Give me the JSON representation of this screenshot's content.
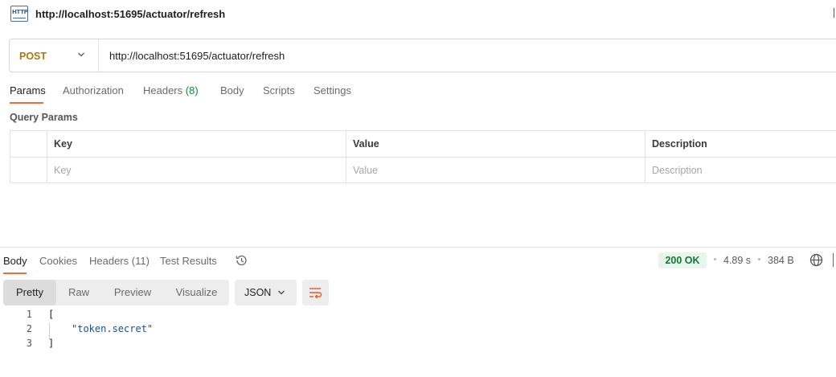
{
  "title": {
    "icon": "http-icon",
    "icon_text": "HTTP",
    "url": "http://localhost:51695/actuator/refresh"
  },
  "request": {
    "method": "POST",
    "url": "http://localhost:51695/actuator/refresh"
  },
  "request_tabs": [
    {
      "label": "Params",
      "active": true
    },
    {
      "label": "Authorization"
    },
    {
      "label": "Headers",
      "count": "(8)"
    },
    {
      "label": "Body"
    },
    {
      "label": "Scripts"
    },
    {
      "label": "Settings"
    }
  ],
  "query_params": {
    "title": "Query Params",
    "columns": [
      "Key",
      "Value",
      "Description"
    ],
    "placeholders": [
      "Key",
      "Value",
      "Description"
    ]
  },
  "response_tabs": [
    {
      "label": "Body",
      "active": true
    },
    {
      "label": "Cookies"
    },
    {
      "label": "Headers (11)"
    },
    {
      "label": "Test Results"
    }
  ],
  "response_meta": {
    "status": "200 OK",
    "time": "4.89 s",
    "size": "384 B"
  },
  "view_modes": [
    "Pretty",
    "Raw",
    "Preview",
    "Visualize"
  ],
  "format": "JSON",
  "code_lines": [
    {
      "n": "1",
      "text": "["
    },
    {
      "n": "2",
      "text": "\"token.secret\""
    },
    {
      "n": "3",
      "text": "]"
    }
  ],
  "colors": {
    "method": "#ad7a03",
    "accent": "#f26b3a",
    "status_ok": "#0f7a36",
    "count": "#0f8a3c"
  }
}
